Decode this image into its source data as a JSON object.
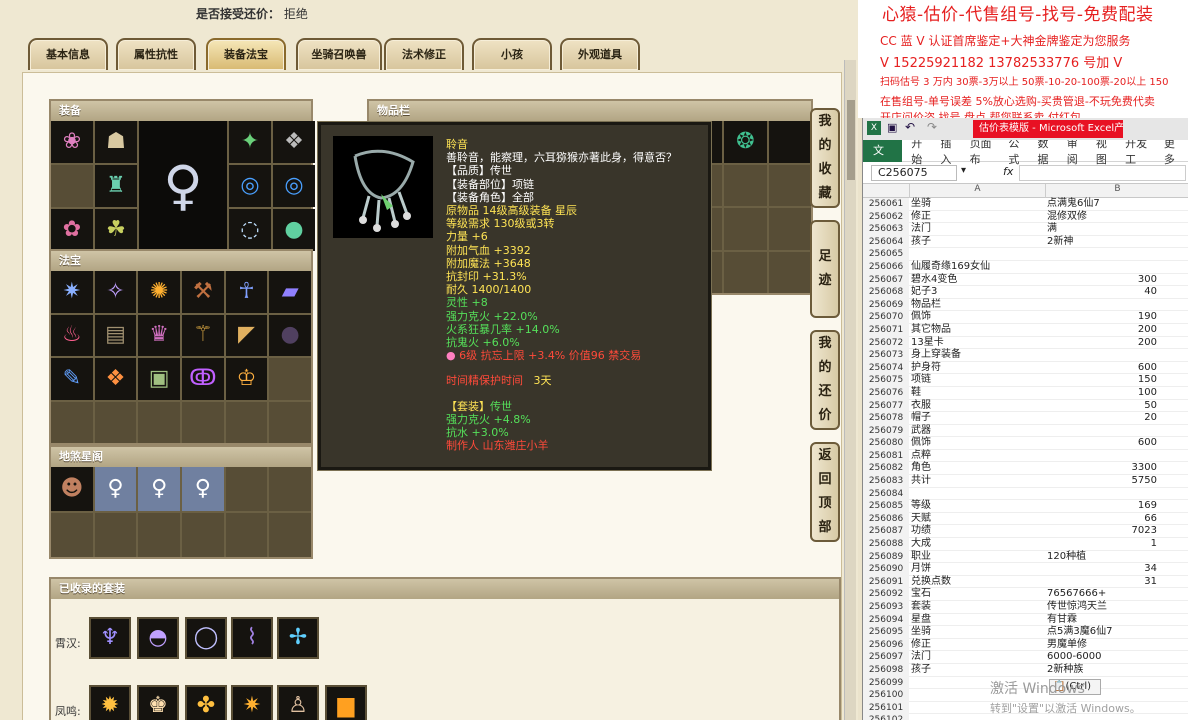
{
  "top_info": {
    "label": "是否接受还价：",
    "value": "拒绝"
  },
  "tabs": [
    {
      "label": "基本信息"
    },
    {
      "label": "属性抗性"
    },
    {
      "label": "装备法宝"
    },
    {
      "label": "坐骑召唤兽"
    },
    {
      "label": "法术修正"
    },
    {
      "label": "小孩"
    },
    {
      "label": "外观道具"
    }
  ],
  "active_tab": "装备法宝",
  "sections": {
    "equipment": "装备",
    "inventory": "物品栏",
    "treasure": "法宝",
    "earth_spirit": "地煞星阁",
    "suits": "已收录的套装"
  },
  "suit_groups": [
    {
      "label": "霄汉:"
    },
    {
      "label": "凤鸣:"
    }
  ],
  "tooltip": {
    "name": "聆音",
    "description": "善聆音，能察理，六耳猕猴亦著此身，得意否？",
    "quality": "【品质】传世",
    "slot": "【装备部位】项链",
    "role": "【装备角色】全部",
    "origin": "原物品 14级高级装备 星辰",
    "level_req": "等级需求 130级或3转",
    "stats": [
      "力量 +6",
      "附加气血 +3392",
      "附加魔法 +3648",
      "抗封印 +31.3%",
      "耐久 1400/1400",
      "灵性 +8",
      "强力克火 +22.0%",
      "火系狂暴几率 +14.0%",
      "抗鬼火 +6.0%"
    ],
    "gem_line": "6级 抗忘上限 +3.4% 价值96 禁交易",
    "protect_label": "时间精保护时间",
    "protect_value": "3天",
    "set_label": "【套装】",
    "set_name": "传世",
    "set_stats": [
      "强力克火 +4.8%",
      "抗水 +3.0%"
    ],
    "maker": "制作人 山东潍庄小羊"
  },
  "side_buttons": [
    {
      "label": "我的收藏"
    },
    {
      "label": "足迹"
    },
    {
      "label": "我的还价"
    },
    {
      "label": "返回顶部"
    }
  ],
  "promo": {
    "headline": "心猿-估价-代售组号-找号-免费配装",
    "lines": [
      "CC 蓝 V 认证首席鉴定+大神金牌鉴定为您服务",
      "V 15225921182  13782533776  号加 V",
      "扫码估号 3 万内 30票-3万以上 50票-10-20-100票-20以上 150",
      "在售组号-单号误差 5%放心选购-买贵管退-不玩免费代卖",
      "开店问价咨 找号 盘点 帮您联系卖 付红包"
    ]
  },
  "excel": {
    "window_title": "估价表模版 - Microsoft Excel产品",
    "ribbon_file": "文件",
    "ribbon_tabs": [
      "开始",
      "插入",
      "页面布",
      "公式",
      "数据",
      "审阅",
      "视图",
      "开发工",
      "更多"
    ],
    "name_box": "C256075",
    "fx": "fx",
    "col_a": "A",
    "col_b": "B",
    "rows": [
      {
        "n": "256061",
        "a": "坐骑",
        "b": "点满鬼6仙7"
      },
      {
        "n": "256062",
        "a": "修正",
        "b": "混修双修"
      },
      {
        "n": "256063",
        "a": "法门",
        "b": "满"
      },
      {
        "n": "256064",
        "a": "孩子",
        "b": "2新神"
      },
      {
        "n": "256065",
        "a": "",
        "b": ""
      },
      {
        "n": "256066",
        "a": "仙履奇缘169女仙",
        "b": ""
      },
      {
        "n": "256067",
        "a": "碧水4变色",
        "b": "300"
      },
      {
        "n": "256068",
        "a": "妃子3",
        "b": "40"
      },
      {
        "n": "256069",
        "a": "物品栏",
        "b": ""
      },
      {
        "n": "256070",
        "a": "佩饰",
        "b": "190"
      },
      {
        "n": "256071",
        "a": "其它物品",
        "b": "200"
      },
      {
        "n": "256072",
        "a": "13星卡",
        "b": "200"
      },
      {
        "n": "256073",
        "a": "身上穿装备",
        "b": ""
      },
      {
        "n": "256074",
        "a": "护身符",
        "b": "600"
      },
      {
        "n": "256075",
        "a": "项链",
        "b": "150"
      },
      {
        "n": "256076",
        "a": "鞋",
        "b": "100"
      },
      {
        "n": "256077",
        "a": "衣服",
        "b": "50"
      },
      {
        "n": "256078",
        "a": "帽子",
        "b": "20"
      },
      {
        "n": "256079",
        "a": "武器",
        "b": ""
      },
      {
        "n": "256080",
        "a": "佩饰",
        "b": "600"
      },
      {
        "n": "256081",
        "a": "点粹",
        "b": ""
      },
      {
        "n": "256082",
        "a": "角色",
        "b": "3300"
      },
      {
        "n": "256083",
        "a": "共计",
        "b": "5750"
      },
      {
        "n": "256084",
        "a": "",
        "b": ""
      },
      {
        "n": "256085",
        "a": "等级",
        "b": "169"
      },
      {
        "n": "256086",
        "a": "天赋",
        "b": "66"
      },
      {
        "n": "256087",
        "a": "功绩",
        "b": "7023"
      },
      {
        "n": "256088",
        "a": "大成",
        "b": "1"
      },
      {
        "n": "256089",
        "a": "职业",
        "b": "120种植"
      },
      {
        "n": "256090",
        "a": "月饼",
        "b": "34"
      },
      {
        "n": "256091",
        "a": "兑换点数",
        "b": "31"
      },
      {
        "n": "256092",
        "a": "宝石",
        "b": "76567666+"
      },
      {
        "n": "256093",
        "a": "套装",
        "b": "传世惊鸿天兰"
      },
      {
        "n": "256094",
        "a": "星盘",
        "b": "有甘霖"
      },
      {
        "n": "256095",
        "a": "坐骑",
        "b": "点5满3魔6仙7"
      },
      {
        "n": "256096",
        "a": "修正",
        "b": "男魔单修"
      },
      {
        "n": "256097",
        "a": "法门",
        "b": "6000-6000"
      },
      {
        "n": "256098",
        "a": "孩子",
        "b": "2新种族"
      },
      {
        "n": "256099",
        "a": "",
        "b": ""
      },
      {
        "n": "256100",
        "a": "",
        "b": ""
      },
      {
        "n": "256101",
        "a": "",
        "b": ""
      },
      {
        "n": "256102",
        "a": "",
        "b": ""
      }
    ],
    "paste_tag": "(Ctrl)"
  },
  "windows_watermark": {
    "line1": "激活 Windows",
    "line2": "转到\"设置\"以激活 Windows。"
  },
  "colors": {
    "tooltip_yellow": "#ffe455",
    "tooltip_green": "#55e05a",
    "tooltip_red": "#ff4a3a",
    "tooltip_white": "#ffffff",
    "promo_red": "#e62020"
  }
}
